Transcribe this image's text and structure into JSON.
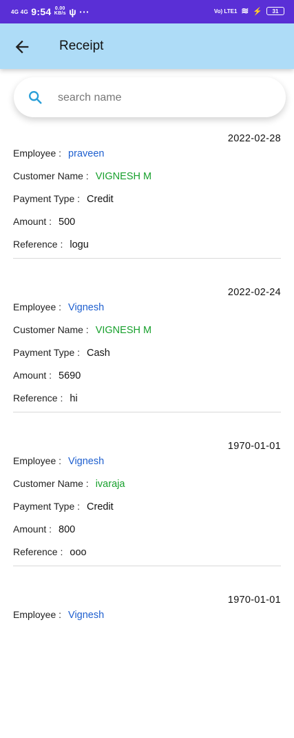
{
  "status_bar": {
    "network": "4G 4G",
    "time": "9:54",
    "speed_value": "0.00",
    "speed_unit": "KB/s",
    "extras": "ψ ···",
    "volte": "Vo) LTE1",
    "wifi": "≋",
    "charging": "⚡",
    "battery": "31"
  },
  "app_bar": {
    "title": "Receipt"
  },
  "search": {
    "placeholder": "search name"
  },
  "labels": {
    "employee": "Employee :",
    "customer_name": "Customer Name :",
    "payment_type": "Payment Type :",
    "amount": "Amount :",
    "reference": "Reference :"
  },
  "receipts": [
    {
      "date": "2022-02-28",
      "employee": "praveen",
      "customer_name": "VIGNESH M",
      "payment_type": "Credit",
      "amount": "500",
      "reference": "logu"
    },
    {
      "date": "2022-02-24",
      "employee": "Vignesh",
      "customer_name": "VIGNESH M",
      "payment_type": "Cash",
      "amount": "5690",
      "reference": "hi"
    },
    {
      "date": "1970-01-01",
      "employee": "Vignesh",
      "customer_name": "ivaraja",
      "payment_type": "Credit",
      "amount": "800",
      "reference": "ooo"
    },
    {
      "date": "1970-01-01",
      "employee": "Vignesh",
      "customer_name": "",
      "payment_type": "",
      "amount": "",
      "reference": ""
    }
  ],
  "colors": {
    "status_bar": "#5a2fd6",
    "app_bar": "#aedcf7",
    "employee_value": "#1e5fcf",
    "customer_value": "#17a02c"
  }
}
